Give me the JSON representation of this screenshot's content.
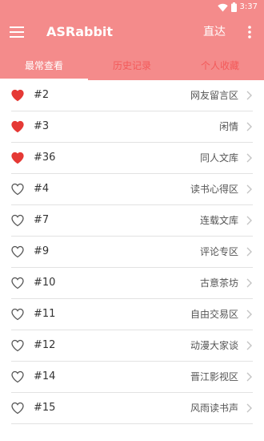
{
  "status": {
    "time": "3:37"
  },
  "app": {
    "title": "ASRabbit",
    "jump_label": "直达"
  },
  "tabs": [
    {
      "label": "最常查看",
      "active": true
    },
    {
      "label": "历史记录",
      "active": false
    },
    {
      "label": "个人收藏",
      "active": false
    }
  ],
  "colors": {
    "accent": "#f48b8b",
    "heart": "#e53935",
    "inactive_tab": "#f35a5a"
  },
  "list": [
    {
      "num": "#2",
      "name": "网友留言区",
      "favorite": true
    },
    {
      "num": "#3",
      "name": "闲情",
      "favorite": true
    },
    {
      "num": "#36",
      "name": "同人文库",
      "favorite": true
    },
    {
      "num": "#4",
      "name": "读书心得区",
      "favorite": false
    },
    {
      "num": "#7",
      "name": "连载文库",
      "favorite": false
    },
    {
      "num": "#9",
      "name": "评论专区",
      "favorite": false
    },
    {
      "num": "#10",
      "name": "古意茶坊",
      "favorite": false
    },
    {
      "num": "#11",
      "name": "自由交易区",
      "favorite": false
    },
    {
      "num": "#12",
      "name": "动漫大家谈",
      "favorite": false
    },
    {
      "num": "#14",
      "name": "晋江影视区",
      "favorite": false
    },
    {
      "num": "#15",
      "name": "风雨读书声",
      "favorite": false
    }
  ]
}
